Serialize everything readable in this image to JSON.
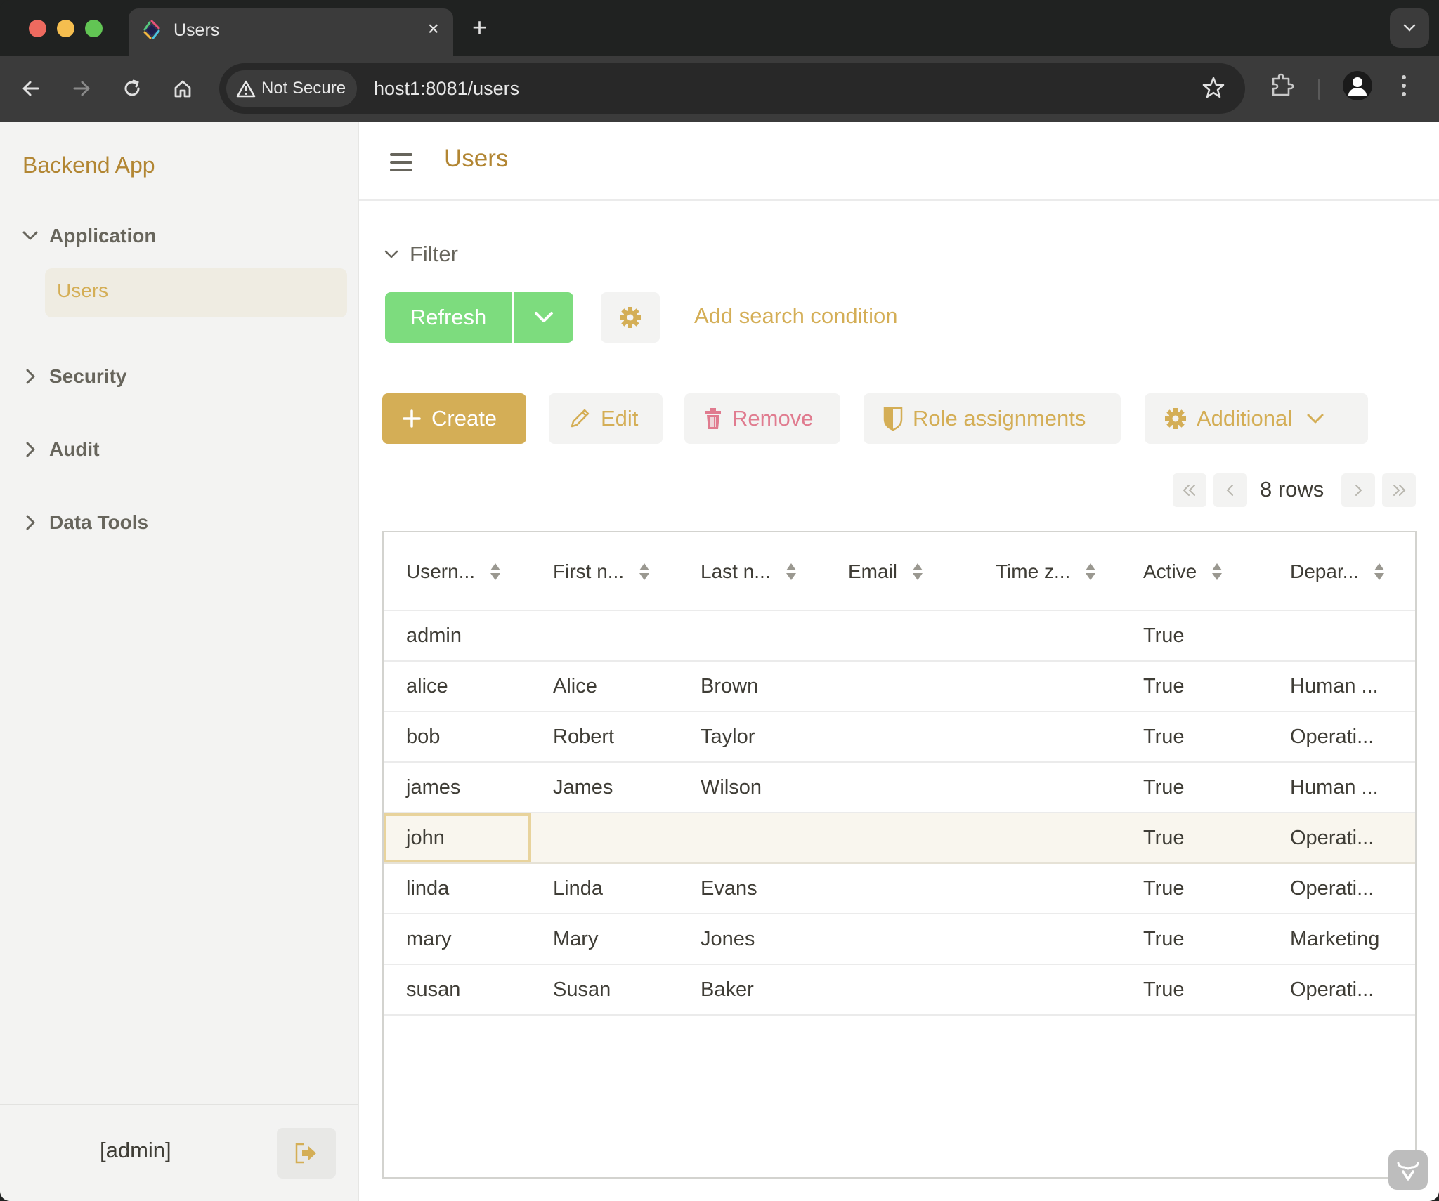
{
  "browser": {
    "tab_title": "Users",
    "new_tab_label": "+",
    "close_tab_label": "×",
    "security_label": "Not Secure",
    "url": "host1:8081/users"
  },
  "sidebar": {
    "brand": "Backend App",
    "groups": [
      {
        "label": "Application",
        "expanded": true,
        "items": [
          {
            "label": "Users",
            "active": true
          }
        ]
      },
      {
        "label": "Security",
        "expanded": false
      },
      {
        "label": "Audit",
        "expanded": false
      },
      {
        "label": "Data Tools",
        "expanded": false
      }
    ],
    "user_label": "[admin]"
  },
  "header": {
    "title": "Users"
  },
  "filter": {
    "label": "Filter",
    "refresh_label": "Refresh",
    "add_condition_label": "Add search condition"
  },
  "actions": {
    "create": "Create",
    "edit": "Edit",
    "remove": "Remove",
    "role_assignments": "Role assignments",
    "additional": "Additional"
  },
  "pagination": {
    "row_count": "8 rows"
  },
  "table": {
    "columns": [
      "Usern...",
      "First n...",
      "Last n...",
      "Email",
      "Time z...",
      "Active",
      "Depar..."
    ],
    "rows": [
      {
        "username": "admin",
        "first": "",
        "last": "",
        "email": "",
        "tz": "",
        "active": "True",
        "dept": ""
      },
      {
        "username": "alice",
        "first": "Alice",
        "last": "Brown",
        "email": "",
        "tz": "",
        "active": "True",
        "dept": "Human ..."
      },
      {
        "username": "bob",
        "first": "Robert",
        "last": "Taylor",
        "email": "",
        "tz": "",
        "active": "True",
        "dept": "Operati..."
      },
      {
        "username": "james",
        "first": "James",
        "last": "Wilson",
        "email": "",
        "tz": "",
        "active": "True",
        "dept": "Human ..."
      },
      {
        "username": "john",
        "first": "",
        "last": "",
        "email": "",
        "tz": "",
        "active": "True",
        "dept": "Operati...",
        "selected": true
      },
      {
        "username": "linda",
        "first": "Linda",
        "last": "Evans",
        "email": "",
        "tz": "",
        "active": "True",
        "dept": "Operati..."
      },
      {
        "username": "mary",
        "first": "Mary",
        "last": "Jones",
        "email": "",
        "tz": "",
        "active": "True",
        "dept": "Marketing"
      },
      {
        "username": "susan",
        "first": "Susan",
        "last": "Baker",
        "email": "",
        "tz": "",
        "active": "True",
        "dept": "Operati..."
      }
    ]
  },
  "colors": {
    "accent": "#d4ae56",
    "brand": "#b28633",
    "refresh": "#7ddc7e",
    "danger": "#e07b8f"
  }
}
